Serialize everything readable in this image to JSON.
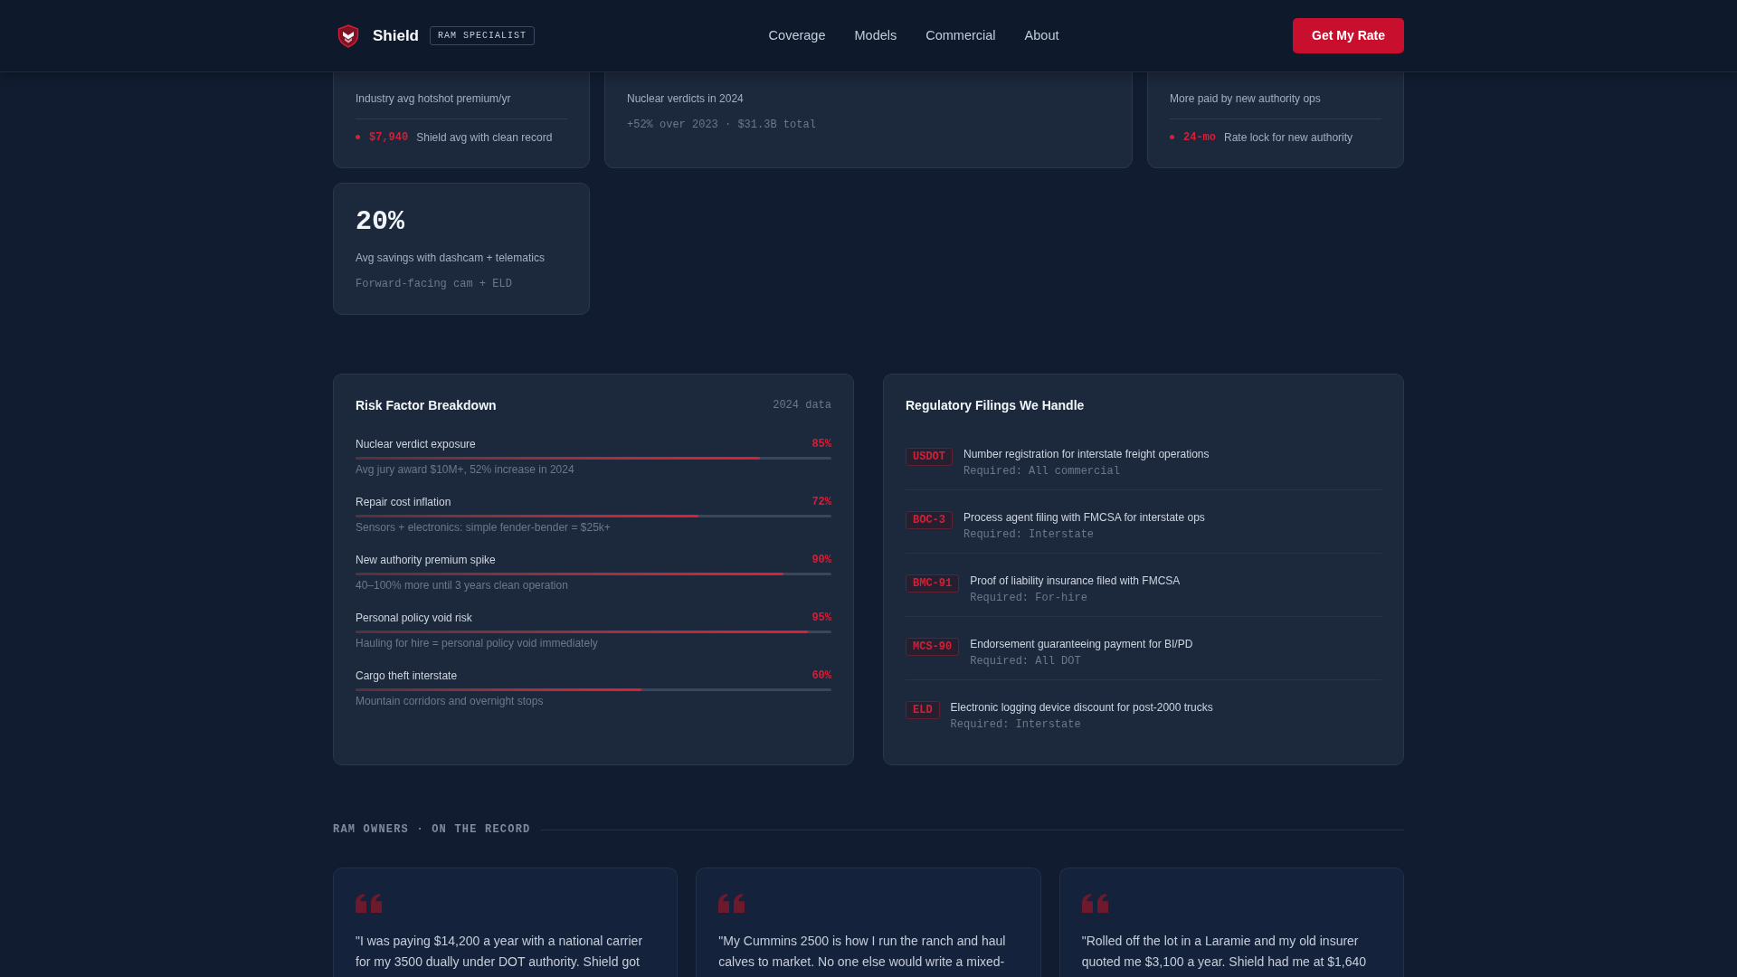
{
  "header": {
    "brand": "Shield",
    "badge": "RAM SPECIALIST",
    "nav": [
      "Coverage",
      "Models",
      "Commercial",
      "About"
    ],
    "cta": "Get My Rate"
  },
  "stats": [
    {
      "kind": "highlight",
      "label": "Industry avg hotshot premium/yr",
      "highlight": {
        "value": "$7,940",
        "text": "Shield avg with clean record"
      }
    },
    {
      "kind": "note",
      "label": "Nuclear verdicts in 2024",
      "note": "+52% over 2023 · $31.3B total"
    },
    {
      "kind": "highlight",
      "label": "More paid by new authority ops",
      "highlight": {
        "value": "24-mo",
        "text": "Rate lock for new authority"
      }
    },
    {
      "kind": "note",
      "value": "20%",
      "label": "Avg savings with dashcam + telematics",
      "note": "Forward-facing cam + ELD"
    }
  ],
  "risk": {
    "title": "Risk Factor Breakdown",
    "meta": "2024 data",
    "factors": [
      {
        "name": "Nuclear verdict exposure",
        "reading": "85%",
        "level": 0.85,
        "detail": "Avg jury award $10M+, 52% increase in 2024"
      },
      {
        "name": "Repair cost inflation",
        "reading": "72%",
        "level": 0.72,
        "detail": "Sensors + electronics: simple fender-bender = $25k+"
      },
      {
        "name": "New authority premium spike",
        "reading": "90%",
        "level": 0.9,
        "detail": "40–100% more until 3 years clean operation"
      },
      {
        "name": "Personal policy void risk",
        "reading": "95%",
        "level": 0.95,
        "detail": "Hauling for hire = personal policy void immediately"
      },
      {
        "name": "Cargo theft interstate",
        "reading": "60%",
        "level": 0.6,
        "detail": "Mountain corridors and overnight stops"
      }
    ]
  },
  "filings": {
    "title": "Regulatory Filings We Handle",
    "items": [
      {
        "code": "USDOT",
        "description": "Number registration for interstate freight operations",
        "requirement": "Required: All commercial"
      },
      {
        "code": "BOC-3",
        "description": "Process agent filing with FMCSA for interstate ops",
        "requirement": "Required: Interstate"
      },
      {
        "code": "BMC-91",
        "description": "Proof of liability insurance filed with FMCSA",
        "requirement": "Required: For-hire"
      },
      {
        "code": "MCS-90",
        "description": "Endorsement guaranteeing payment for BI/PD",
        "requirement": "Required: All DOT"
      },
      {
        "code": "ELD",
        "description": "Electronic logging device discount for post-2000 trucks",
        "requirement": "Required: Interstate"
      }
    ]
  },
  "testimonials": {
    "heading": "RAM OWNERS · ON THE RECORD",
    "quotes": [
      "\"I was paying $14,200 a year with a national carrier for my 3500 dually under DOT authority. Shield got",
      "\"My Cummins 2500 is how I run the ranch and haul calves to market. No one else would write a mixed-",
      "\"Rolled off the lot in a Laramie and my old insurer quoted me $3,100 a year. Shield had me at $1,640"
    ]
  }
}
